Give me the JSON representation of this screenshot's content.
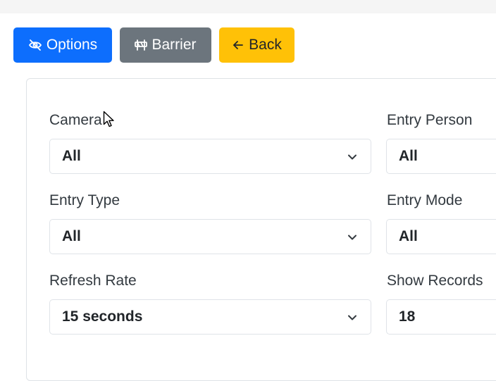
{
  "toolbar": {
    "options_label": "Options",
    "barrier_label": "Barrier",
    "back_label": "Back"
  },
  "filters": {
    "camera": {
      "label": "Camera",
      "value": "All"
    },
    "entry_person": {
      "label": "Entry Person",
      "value": "All"
    },
    "entry_type": {
      "label": "Entry Type",
      "value": "All"
    },
    "entry_mode": {
      "label": "Entry Mode",
      "value": "All"
    },
    "refresh_rate": {
      "label": "Refresh Rate",
      "value": "15 seconds"
    },
    "show_records": {
      "label": "Show Records",
      "value": "18"
    }
  },
  "colors": {
    "primary": "#0d6efd",
    "secondary": "#6c757d",
    "warning": "#ffc107"
  },
  "icons": {
    "options": "eye-slash-icon",
    "barrier": "barrier-icon",
    "back": "arrow-left-icon",
    "select": "chevron-down-icon"
  }
}
